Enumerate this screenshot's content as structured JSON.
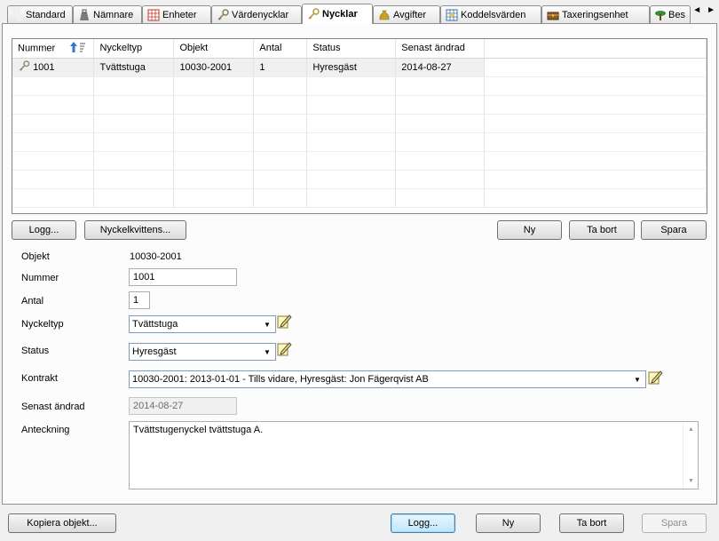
{
  "tabs": [
    {
      "label": "Standard",
      "icon": "none",
      "active": false
    },
    {
      "label": "Nämnare",
      "icon": "bag-icon",
      "active": false
    },
    {
      "label": "Enheter",
      "icon": "grid-icon",
      "active": false
    },
    {
      "label": "Värdenycklar",
      "icon": "key-icon",
      "active": false
    },
    {
      "label": "Nycklar",
      "icon": "key-icon",
      "active": true
    },
    {
      "label": "Avgifter",
      "icon": "money-bag-icon",
      "active": false
    },
    {
      "label": "Koddelsvärden",
      "icon": "table-icon",
      "active": false
    },
    {
      "label": "Taxeringsenhet",
      "icon": "chest-icon",
      "active": false
    },
    {
      "label": "Bes",
      "icon": "tree-icon",
      "active": false
    }
  ],
  "tab_scroll": {
    "left": "◄",
    "right": "►"
  },
  "grid": {
    "columns": [
      "Nummer",
      "Nyckeltyp",
      "Objekt",
      "Antal",
      "Status",
      "Senast ändrad"
    ],
    "rows": [
      {
        "nummer": "1001",
        "nyckeltyp": "Tvättstuga",
        "objekt": "10030-2001",
        "antal": "1",
        "status": "Hyresgäst",
        "senast": "2014-08-27"
      }
    ]
  },
  "grid_buttons": {
    "logg": "Logg...",
    "kvittens": "Nyckelkvittens...",
    "ny": "Ny",
    "ta_bort": "Ta bort",
    "spara": "Spara"
  },
  "form": {
    "objekt_label": "Objekt",
    "objekt_value": "10030-2001",
    "nummer_label": "Nummer",
    "nummer_value": "1001",
    "antal_label": "Antal",
    "antal_value": "1",
    "nyckeltyp_label": "Nyckeltyp",
    "nyckeltyp_value": "Tvättstuga",
    "status_label": "Status",
    "status_value": "Hyresgäst",
    "kontrakt_label": "Kontrakt",
    "kontrakt_value": "10030-2001: 2013-01-01 - Tills vidare, Hyresgäst: Jon Fägerqvist AB",
    "senast_label": "Senast ändrad",
    "senast_value": "2014-08-27",
    "anteckning_label": "Anteckning",
    "anteckning_value": "Tvättstugenyckel tvättstuga A."
  },
  "footer": {
    "kopiera": "Kopiera objekt...",
    "logg": "Logg...",
    "ny": "Ny",
    "ta_bort": "Ta bort",
    "spara": "Spara"
  }
}
